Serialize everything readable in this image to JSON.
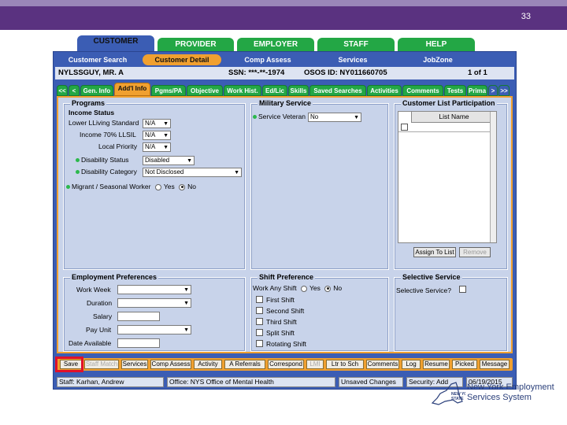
{
  "slide": {
    "number": "33"
  },
  "top_tabs": [
    {
      "label": "CUSTOMER",
      "active": true
    },
    {
      "label": "PROVIDER"
    },
    {
      "label": "EMPLOYER"
    },
    {
      "label": "STAFF"
    },
    {
      "label": "HELP"
    }
  ],
  "sub_nav": [
    "Customer Search",
    "Customer Detail",
    "Comp Assess",
    "Services",
    "JobZone"
  ],
  "customer": {
    "name": "NYLSSGUY, MR. A",
    "ssn": "SSN: ***-**-1974",
    "osos_id": "OSOS ID: NY011660705",
    "record": "1 of 1"
  },
  "tabs": [
    "<<",
    "<",
    "Gen. Info",
    "Add'l Info",
    "Pgms/PA",
    "Objective",
    "Work Hist.",
    "Ed/Lic",
    "Skills",
    "Saved Searches",
    "Activities",
    "Comments",
    "Tests",
    "Prima",
    ">",
    ">>"
  ],
  "programs": {
    "title": "Programs",
    "income_status": "Income Status",
    "lower_living_label": "Lower LLiving Standard",
    "lower_living_value": "N/A",
    "income70_label": "Income 70% LLSIL",
    "income70_value": "N/A",
    "local_priority_label": "Local Priority",
    "local_priority_value": "N/A",
    "disability_status_label": "Disability Status",
    "disability_status_value": "Disabled",
    "disability_category_label": "Disability Category",
    "disability_category_value": "Not Disclosed",
    "migrant_label": "Migrant / Seasonal Worker",
    "yes": "Yes",
    "no": "No"
  },
  "military": {
    "title": "Military Service",
    "veteran_label": "Service Veteran",
    "veteran_value": "No"
  },
  "customer_list": {
    "title": "Customer List Participation",
    "column": "List Name",
    "assign_button": "Assign To List",
    "remove_button": "Remove"
  },
  "employment": {
    "title": "Employment Preferences",
    "work_week": "Work Week",
    "duration": "Duration",
    "salary": "Salary",
    "pay_unit": "Pay Unit",
    "date_available": "Date Available"
  },
  "shift": {
    "title": "Shift Preference",
    "work_any_label": "Work Any Shift",
    "yes": "Yes",
    "no": "No",
    "options": [
      "First Shift",
      "Second Shift",
      "Third Shift",
      "Split Shift",
      "Rotating Shift"
    ]
  },
  "selective": {
    "title": "Selective Service",
    "question": "Selective Service?"
  },
  "bottom_buttons": [
    "Save",
    "Staff Match",
    "Services",
    "Comp Assess",
    "Activity",
    "A Referrals",
    "Correspond",
    "LMI",
    "Ltr to Sch",
    "Comments",
    "Log",
    "Resume",
    "Picked",
    "Message"
  ],
  "status": {
    "staff": "Staff: Karhan, Andrew",
    "office": "Office: NYS Office of Mental Health",
    "unsaved": "Unsaved Changes",
    "security": "Security: Add",
    "date": "06/19/2015"
  },
  "logo": {
    "state": "NEW YORK STATE",
    "line1": "New York Employment",
    "line2": "Services System"
  }
}
